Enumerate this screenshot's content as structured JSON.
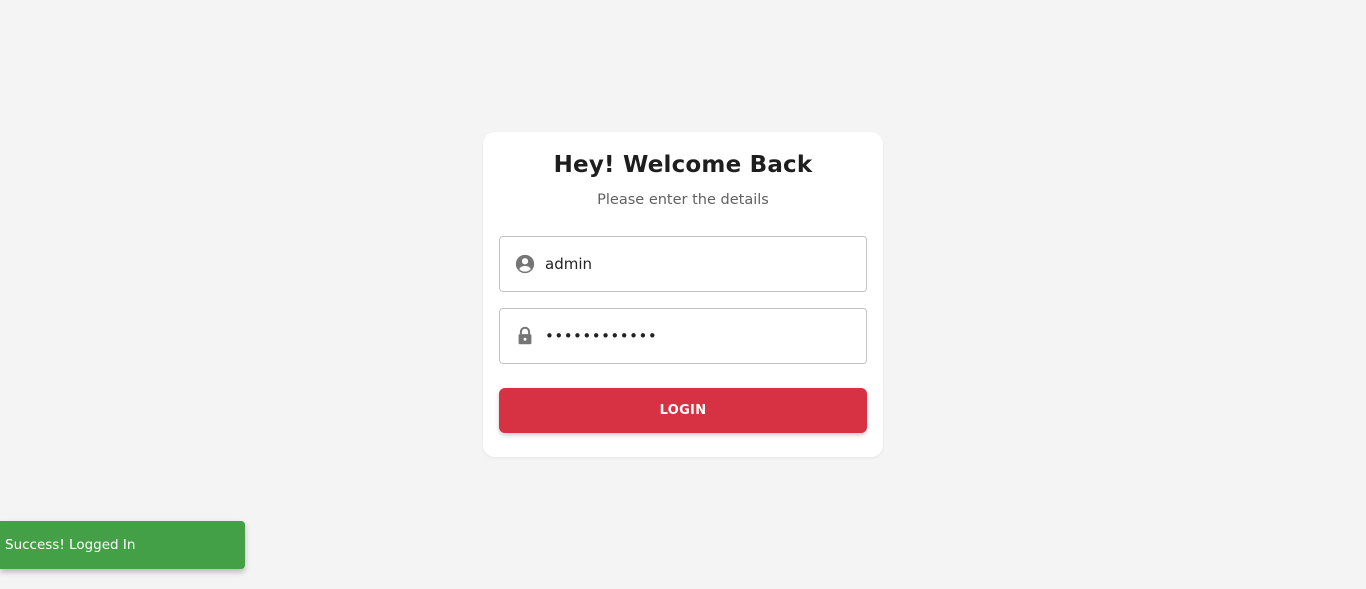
{
  "login_card": {
    "title": "Hey! Welcome Back",
    "subtitle": "Please enter the details",
    "username": {
      "icon": "account-circle-icon",
      "value": "admin"
    },
    "password": {
      "icon": "lock-icon",
      "value": "adminpass123"
    },
    "login_button_label": "LOGIN"
  },
  "toast": {
    "message": "Success! Logged In"
  },
  "colors": {
    "background": "#f4f4f4",
    "card": "#ffffff",
    "primary_button": "#d63244",
    "success_toast": "#43a047",
    "icon": "#757575"
  }
}
